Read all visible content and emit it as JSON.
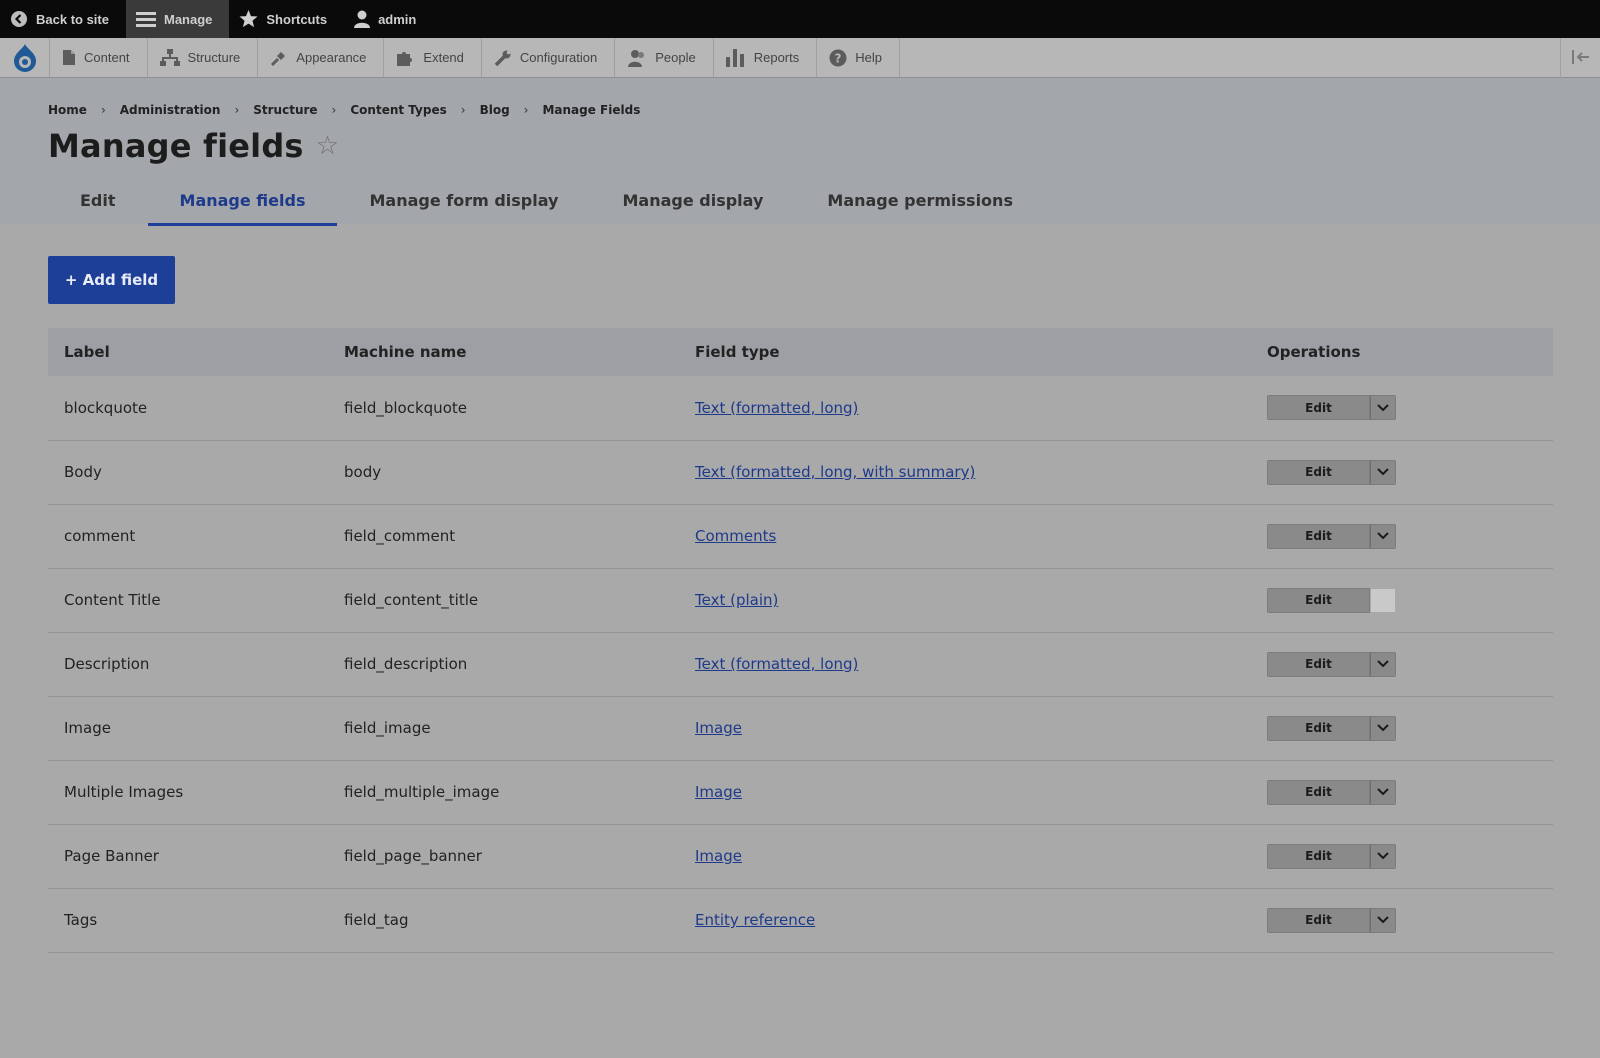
{
  "toolbar": {
    "back_label": "Back to site",
    "manage_label": "Manage",
    "shortcuts_label": "Shortcuts",
    "user_label": "admin"
  },
  "tray": {
    "items": [
      {
        "label": "Content",
        "icon": "document-icon"
      },
      {
        "label": "Structure",
        "icon": "sitemap-icon"
      },
      {
        "label": "Appearance",
        "icon": "paintbrush-icon"
      },
      {
        "label": "Extend",
        "icon": "puzzle-icon"
      },
      {
        "label": "Configuration",
        "icon": "wrench-icon"
      },
      {
        "label": "People",
        "icon": "people-icon"
      },
      {
        "label": "Reports",
        "icon": "bar-chart-icon"
      },
      {
        "label": "Help",
        "icon": "question-icon"
      }
    ]
  },
  "breadcrumb": [
    "Home",
    "Administration",
    "Structure",
    "Content Types",
    "Blog",
    "Manage Fields"
  ],
  "page": {
    "title": "Manage fields",
    "star": "☆"
  },
  "tabs": [
    {
      "label": "Edit",
      "active": false
    },
    {
      "label": "Manage fields",
      "active": true
    },
    {
      "label": "Manage form display",
      "active": false
    },
    {
      "label": "Manage display",
      "active": false
    },
    {
      "label": "Manage permissions",
      "active": false
    }
  ],
  "main": {
    "add_button_label": "+ Add field"
  },
  "table": {
    "headers": [
      "Label",
      "Machine name",
      "Field type",
      "Operations"
    ],
    "edit_label": "Edit",
    "rows": [
      {
        "label": "blockquote",
        "machine": "field_blockquote",
        "type": "Text (formatted, long)",
        "dropdown": true
      },
      {
        "label": "Body",
        "machine": "body",
        "type": "Text (formatted, long, with summary)",
        "dropdown": true
      },
      {
        "label": "comment",
        "machine": "field_comment",
        "type": "Comments",
        "dropdown": true
      },
      {
        "label": "Content Title",
        "machine": "field_content_title",
        "type": "Text (plain)",
        "dropdown": false
      },
      {
        "label": "Description",
        "machine": "field_description",
        "type": "Text (formatted, long)",
        "dropdown": true
      },
      {
        "label": "Image",
        "machine": "field_image",
        "type": "Image",
        "dropdown": true
      },
      {
        "label": "Multiple Images",
        "machine": "field_multiple_image",
        "type": "Image",
        "dropdown": true
      },
      {
        "label": "Page Banner",
        "machine": "field_page_banner",
        "type": "Image",
        "dropdown": true
      },
      {
        "label": "Tags",
        "machine": "field_tag",
        "type": "Entity reference",
        "dropdown": true
      }
    ]
  },
  "colors": {
    "accent": "#1e3f98",
    "link": "#1e3a8a"
  }
}
